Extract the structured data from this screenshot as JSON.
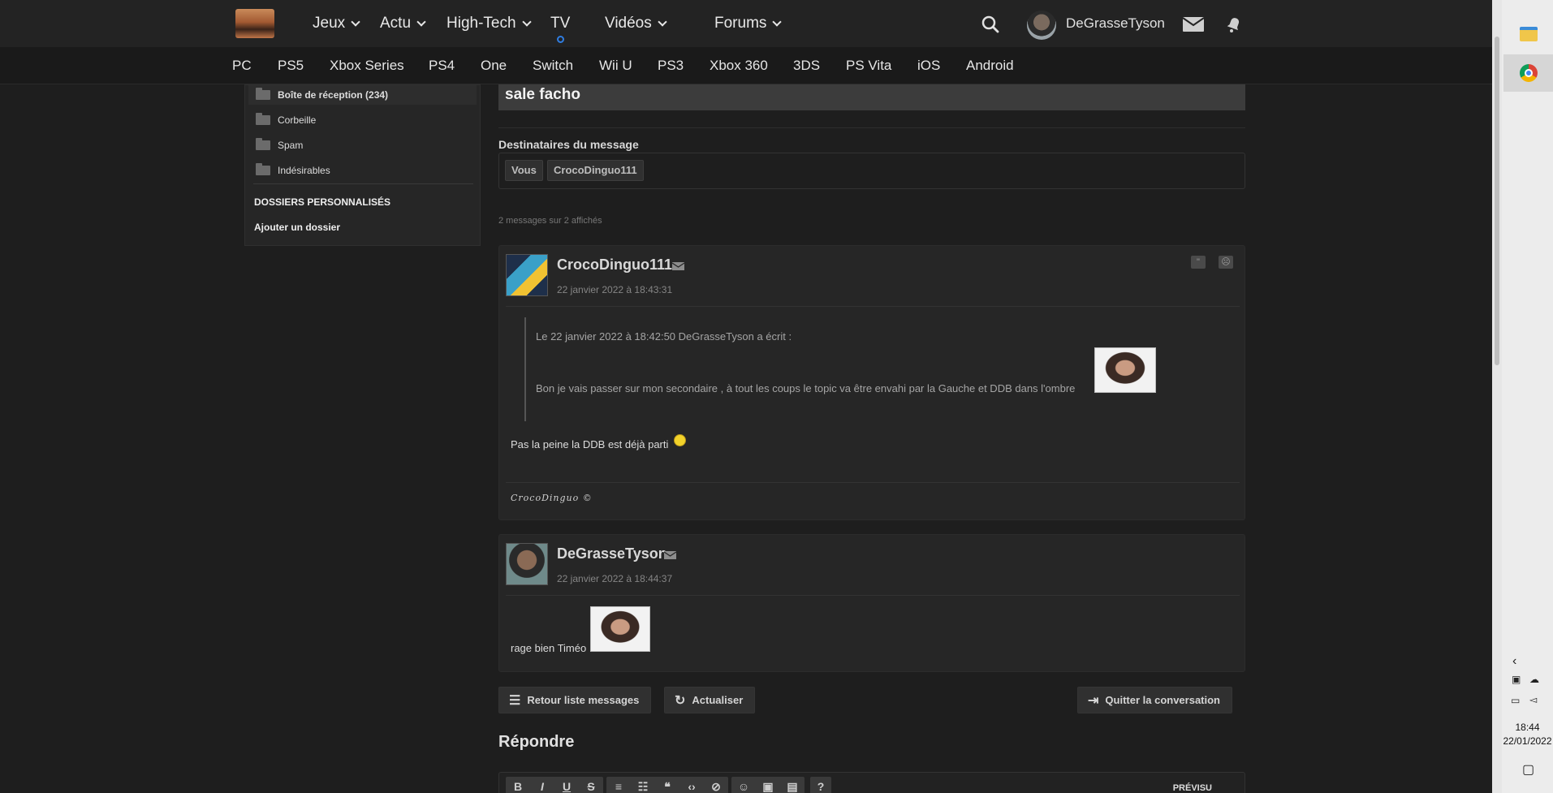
{
  "header": {
    "nav": [
      {
        "label": "Jeux",
        "dropdown": true
      },
      {
        "label": "Actu",
        "dropdown": true
      },
      {
        "label": "High-Tech",
        "dropdown": true
      },
      {
        "label": "TV",
        "dropdown": false
      },
      {
        "label": "Vidéos",
        "dropdown": true
      },
      {
        "label": "Forums",
        "dropdown": true
      }
    ],
    "username": "DeGrasseTyson",
    "icons": {
      "search": "search-icon",
      "mail": "mail-icon",
      "notifications": "bell-icon"
    }
  },
  "platforms": [
    "PC",
    "PS5",
    "Xbox Series",
    "PS4",
    "One",
    "Switch",
    "Wii U",
    "PS3",
    "Xbox 360",
    "3DS",
    "PS Vita",
    "iOS",
    "Android"
  ],
  "sidebar": {
    "folders": [
      {
        "label": "Boîte de réception (234)",
        "active": true
      },
      {
        "label": "Corbeille",
        "active": false
      },
      {
        "label": "Spam",
        "active": false
      },
      {
        "label": "Indésirables",
        "active": false
      }
    ],
    "custom_title": "DOSSIERS PERSONNALISÉS",
    "add_folder": "Ajouter un dossier"
  },
  "conversation": {
    "subject": "sale facho",
    "recipients_title": "Destinataires du message",
    "recipients": [
      "Vous",
      "CrocoDinguo111"
    ],
    "count_text": "2 messages sur 2 affichés",
    "messages": [
      {
        "author": "CrocoDinguo111",
        "date": "22 janvier 2022 à 18:43:31",
        "quote_header": "Le 22 janvier 2022 à 18:42:50 DeGrasseTyson a écrit :",
        "quote_text": "Bon je vais passer sur mon secondaire , à tout les coups le topic va être envahi par la Gauche et DDB dans l'ombre",
        "text": "Pas la peine la DDB est déjà parti",
        "signature": "CrocoDinguo ©"
      },
      {
        "author": "DeGrasseTyson",
        "date": "22 janvier 2022 à 18:44:37",
        "text": "rage bien Timéo"
      }
    ]
  },
  "actions": {
    "back": "Retour liste messages",
    "refresh": "Actualiser",
    "quit": "Quitter la conversation"
  },
  "reply": {
    "title": "Répondre",
    "preview": "PRÉVISU",
    "toolbar": [
      "B",
      "I",
      "U",
      "S"
    ]
  },
  "taskbar": {
    "time": "18:44",
    "date": "22/01/2022"
  }
}
